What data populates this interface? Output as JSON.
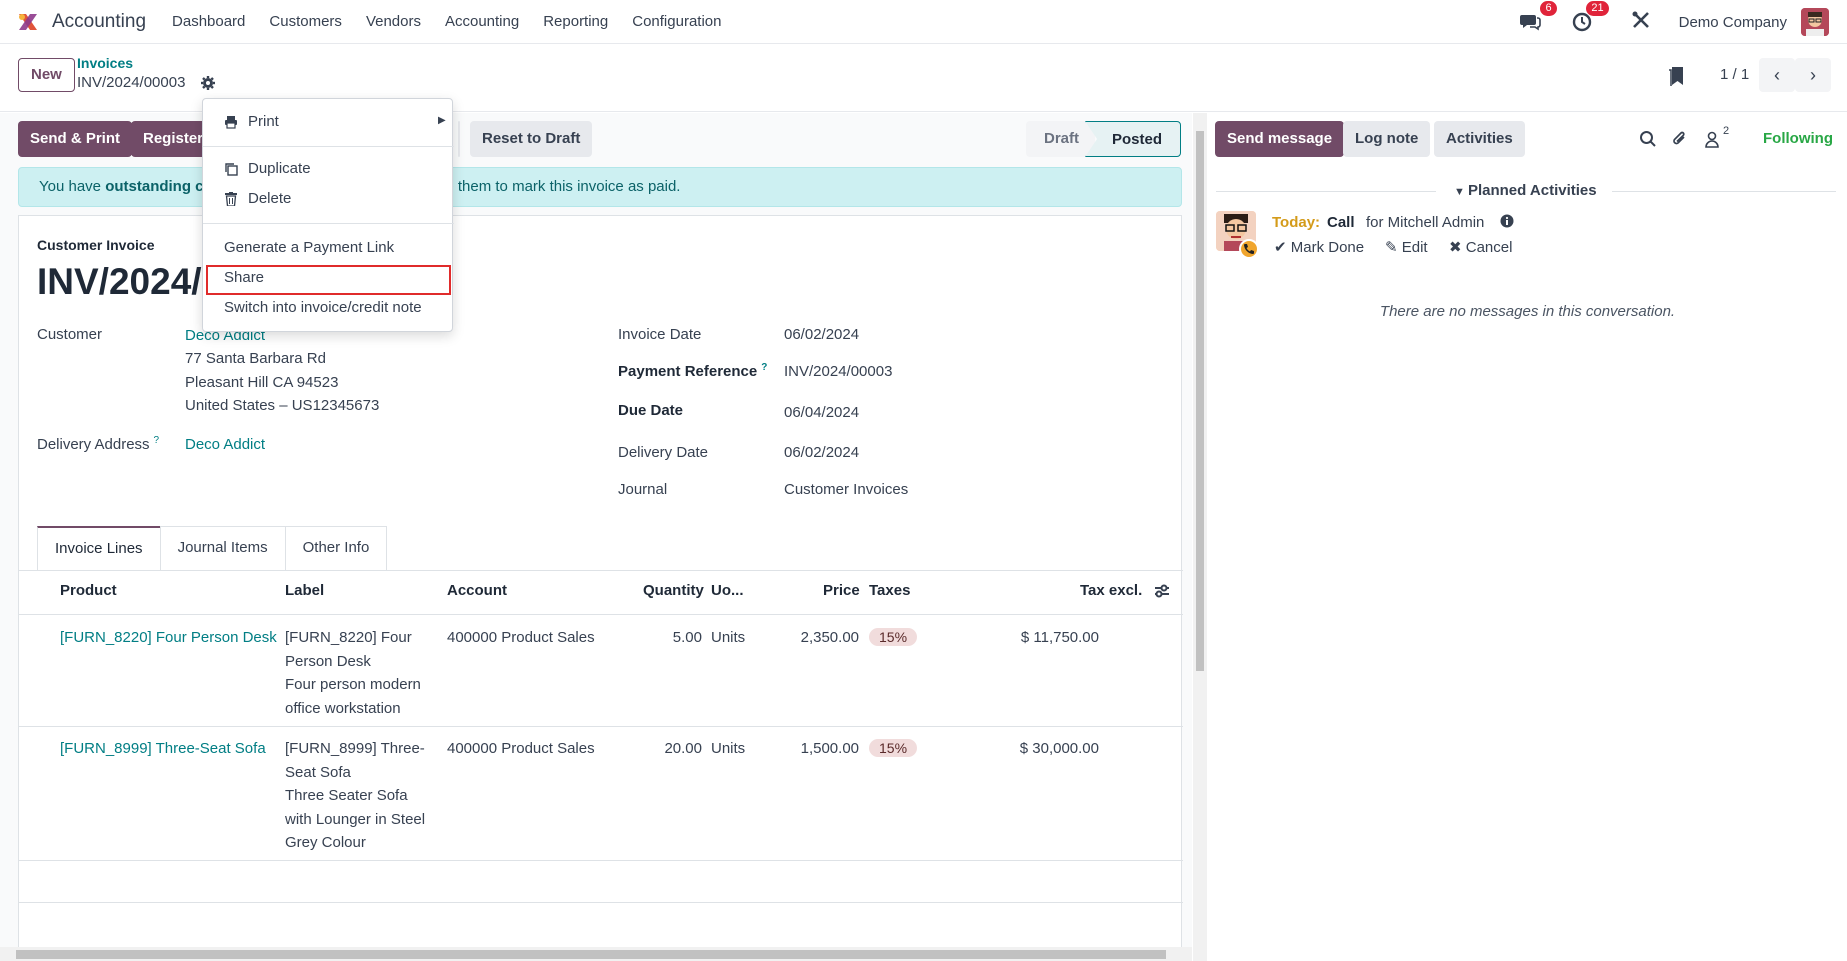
{
  "nav": {
    "app_title": "Accounting",
    "menu": [
      "Dashboard",
      "Customers",
      "Vendors",
      "Accounting",
      "Reporting",
      "Configuration"
    ],
    "messages_badge": "6",
    "activities_badge": "21",
    "company": "Demo Company"
  },
  "control_panel": {
    "new_label": "New",
    "breadcrumb_parent": "Invoices",
    "breadcrumb_current": "INV/2024/00003",
    "pager": "1 / 1"
  },
  "actions": {
    "send_print": "Send & Print",
    "register": "Register",
    "reset_to_draft": "Reset to Draft"
  },
  "status": {
    "draft": "Draft",
    "posted": "Posted"
  },
  "alert": {
    "prefix": "You have ",
    "bold": "outstanding cr",
    "suffix": "cate them to mark this invoice as paid."
  },
  "form": {
    "type_label": "Customer Invoice",
    "number_partial": "INV/2024/",
    "customer_label": "Customer",
    "customer_name": "Deco Addict",
    "address_line1": "77 Santa Barbara Rd",
    "address_line2": "Pleasant Hill CA 94523",
    "address_line3": "United States – US12345673",
    "delivery_address_label": "Delivery Address",
    "delivery_address_help": "?",
    "delivery_address_value": "Deco Addict",
    "invoice_date_label": "Invoice Date",
    "invoice_date": "06/02/2024",
    "payment_reference_label": "Payment Reference",
    "payment_reference_help": "?",
    "payment_reference": "INV/2024/00003",
    "due_date_label": "Due Date",
    "due_date": "06/04/2024",
    "delivery_date_label": "Delivery Date",
    "delivery_date": "06/02/2024",
    "journal_label": "Journal",
    "journal": "Customer Invoices"
  },
  "tabs": [
    "Invoice Lines",
    "Journal Items",
    "Other Info"
  ],
  "lines": {
    "headers": {
      "product": "Product",
      "label": "Label",
      "account": "Account",
      "quantity": "Quantity",
      "uom": "Uo...",
      "price": "Price",
      "taxes": "Taxes",
      "tax_excl": "Tax excl."
    },
    "rows": [
      {
        "product": "[FURN_8220] Four Person Desk",
        "label_lines": [
          "[FURN_8220] Four",
          "Person Desk",
          "Four person modern",
          "office workstation"
        ],
        "account": "400000 Product Sales",
        "quantity": "5.00",
        "uom": "Units",
        "price": "2,350.00",
        "tax": "15%",
        "subtotal": "$ 11,750.00"
      },
      {
        "product": "[FURN_8999] Three-Seat Sofa",
        "label_lines": [
          "[FURN_8999] Three-",
          "Seat Sofa",
          "Three Seater Sofa",
          "with Lounger in Steel",
          "Grey Colour"
        ],
        "account": "400000 Product Sales",
        "quantity": "20.00",
        "uom": "Units",
        "price": "1,500.00",
        "tax": "15%",
        "subtotal": "$ 30,000.00"
      }
    ]
  },
  "dropdown": {
    "print": "Print",
    "duplicate": "Duplicate",
    "delete": "Delete",
    "payment_link": "Generate a Payment Link",
    "share": "Share",
    "switch": "Switch into invoice/credit note"
  },
  "chatter": {
    "send_message": "Send message",
    "log_note": "Log note",
    "activities": "Activities",
    "followers_count": "2",
    "following": "Following",
    "planned_activities": "Planned Activities",
    "activity_when": "Today:",
    "activity_type": "Call",
    "activity_for": "for Mitchell Admin",
    "mark_done": "Mark Done",
    "edit": "Edit",
    "cancel": "Cancel",
    "no_messages": "There are no messages in this conversation."
  },
  "colors": {
    "primary": "#714b67",
    "link": "#017e84",
    "following": "#28a745",
    "badge": "#e0243a"
  }
}
